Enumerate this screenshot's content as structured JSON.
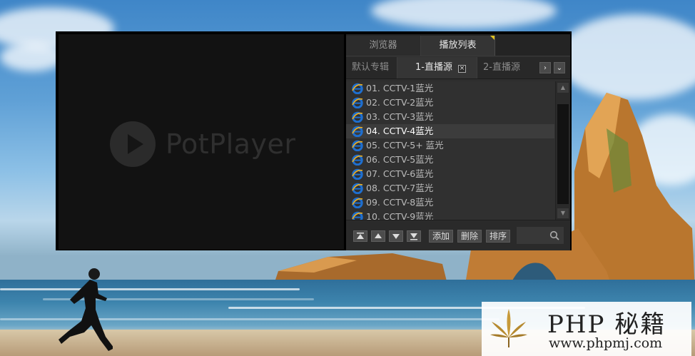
{
  "player": {
    "logo_text": "PotPlayer",
    "top_tabs": [
      {
        "label": "浏览器"
      },
      {
        "label": "播放列表"
      }
    ],
    "sub_tabs": [
      {
        "label": "默认专辑"
      },
      {
        "label": "1-直播源"
      },
      {
        "label": "2-直播源"
      }
    ],
    "close_glyph": "×",
    "nav": {
      "next_glyph": "›",
      "menu_glyph": "⌄"
    },
    "playlist": [
      {
        "label": "01. CCTV-1蓝光"
      },
      {
        "label": "02. CCTV-2蓝光"
      },
      {
        "label": "03. CCTV-3蓝光"
      },
      {
        "label": "04. CCTV-4蓝光",
        "active": true
      },
      {
        "label": "05. CCTV-5+ 蓝光"
      },
      {
        "label": "06. CCTV-5蓝光"
      },
      {
        "label": "07. CCTV-6蓝光"
      },
      {
        "label": "08. CCTV-7蓝光"
      },
      {
        "label": "09. CCTV-8蓝光"
      },
      {
        "label": "10. CCTV-9蓝光"
      }
    ],
    "toolbar": {
      "move_top": "⏫",
      "move_up": "▲",
      "move_down": "▼",
      "move_bottom": "⏬",
      "add_label": "添加",
      "delete_label": "删除",
      "sort_label": "排序"
    }
  },
  "watermark": {
    "title": "PHP 秘籍",
    "url": "www.phpmj.com"
  },
  "colors": {
    "panel_bg": "#2e2e2e",
    "active_tab_marker": "#e0c020",
    "ie_blue": "#1e6fd0",
    "ie_gold": "#f0b020"
  }
}
